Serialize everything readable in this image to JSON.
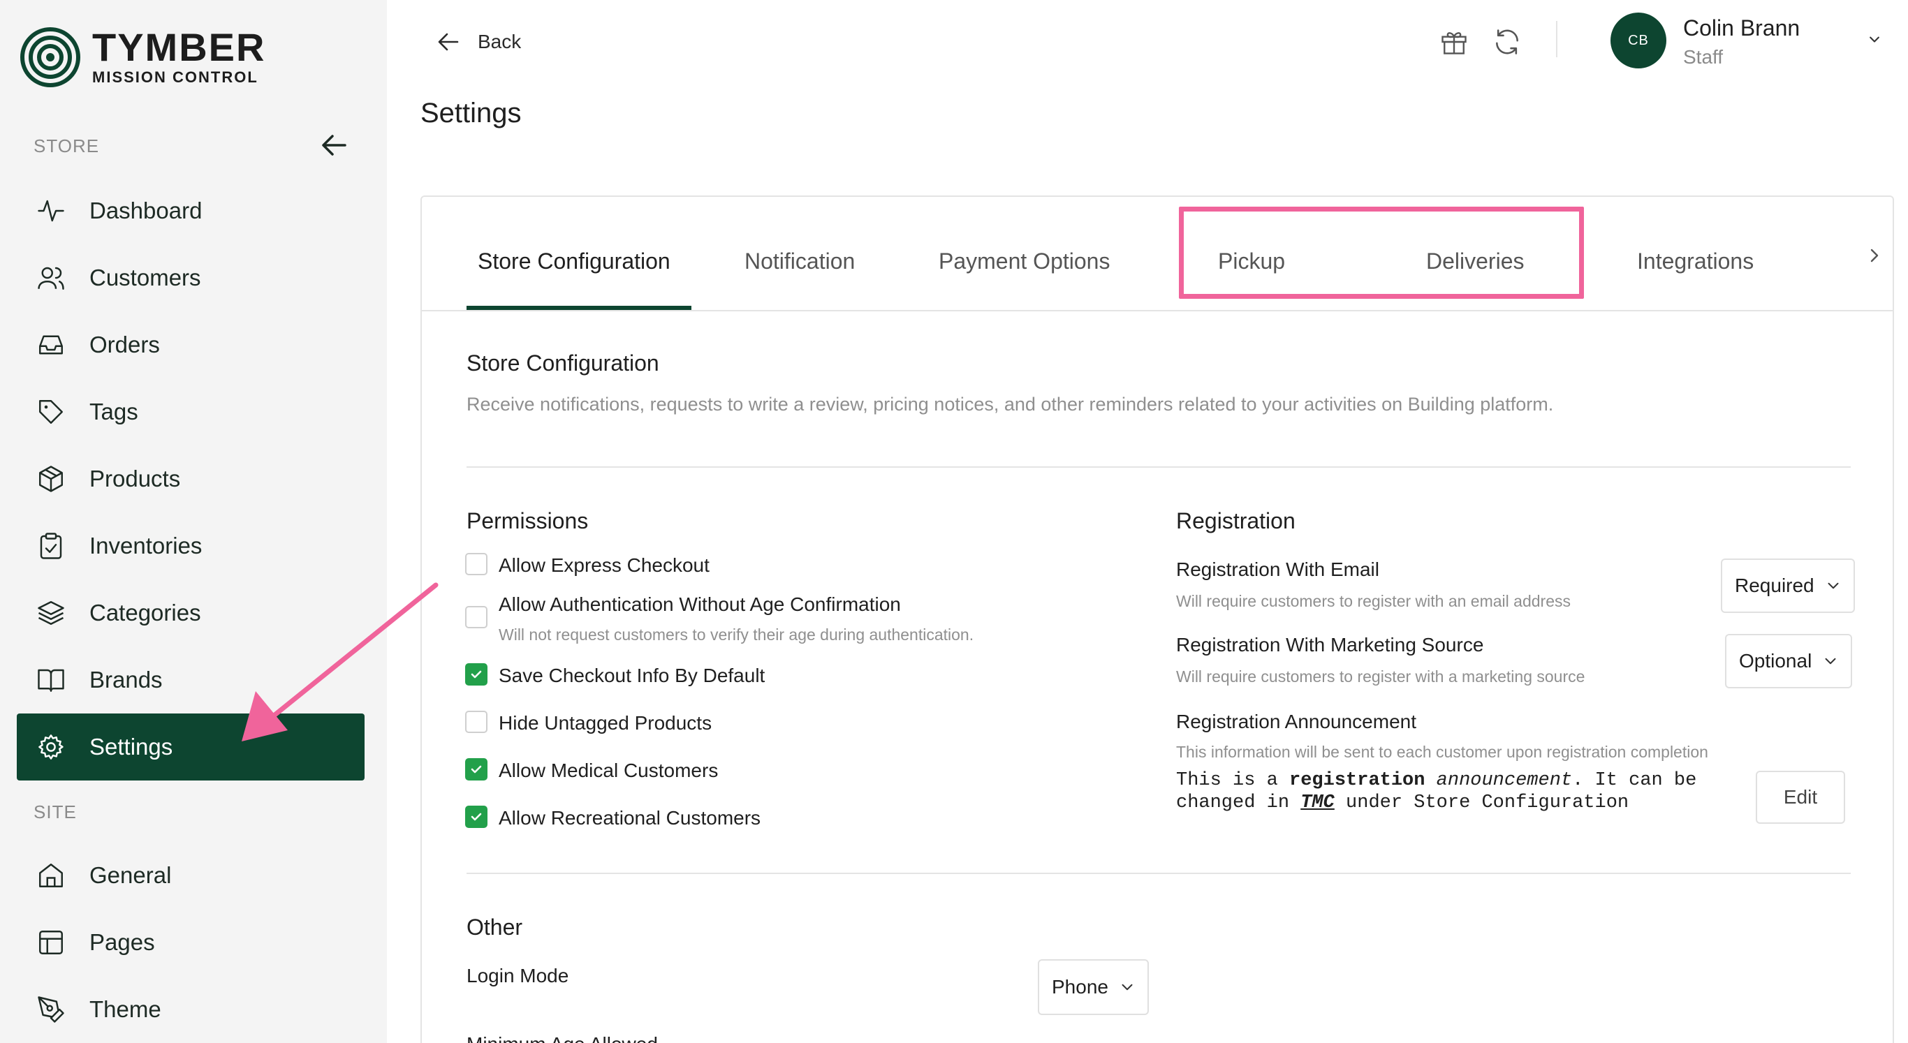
{
  "brand": {
    "title": "TYMBER",
    "subtitle": "MISSION CONTROL",
    "color": "#0d4530"
  },
  "sidebar": {
    "store_label": "STORE",
    "site_label": "SITE",
    "store_items": [
      {
        "label": "Dashboard",
        "icon": "activity-icon"
      },
      {
        "label": "Customers",
        "icon": "users-icon"
      },
      {
        "label": "Orders",
        "icon": "inbox-icon"
      },
      {
        "label": "Tags",
        "icon": "tag-icon"
      },
      {
        "label": "Products",
        "icon": "box-icon"
      },
      {
        "label": "Inventories",
        "icon": "clipboard-check-icon"
      },
      {
        "label": "Categories",
        "icon": "layers-icon"
      },
      {
        "label": "Brands",
        "icon": "book-open-icon"
      },
      {
        "label": "Settings",
        "icon": "gear-icon",
        "active": true
      }
    ],
    "site_items": [
      {
        "label": "General",
        "icon": "home-icon"
      },
      {
        "label": "Pages",
        "icon": "layout-icon"
      },
      {
        "label": "Theme",
        "icon": "pen-tool-icon"
      }
    ]
  },
  "header": {
    "back_label": "Back",
    "page_title": "Settings",
    "icons": [
      "gift-icon",
      "refresh-icon"
    ],
    "user": {
      "initials": "CB",
      "name": "Colin Brann",
      "role": "Staff"
    }
  },
  "tabs": [
    {
      "label": "Store Configuration",
      "active": true
    },
    {
      "label": "Notification"
    },
    {
      "label": "Payment Options"
    },
    {
      "label": "Pickup"
    },
    {
      "label": "Deliveries"
    },
    {
      "label": "Integrations"
    }
  ],
  "store_config": {
    "title": "Store Configuration",
    "description": "Receive notifications, requests to write a review, pricing notices, and other reminders related to your activities on Building platform."
  },
  "permissions": {
    "title": "Permissions",
    "items": [
      {
        "label": "Allow Express Checkout",
        "checked": false
      },
      {
        "label": "Allow Authentication Without Age Confirmation",
        "help": "Will not request customers to verify their age during authentication.",
        "checked": false
      },
      {
        "label": "Save Checkout Info By Default",
        "checked": true
      },
      {
        "label": "Hide Untagged Products",
        "checked": false
      },
      {
        "label": "Allow Medical Customers",
        "checked": true
      },
      {
        "label": "Allow Recreational Customers",
        "checked": true
      }
    ]
  },
  "registration": {
    "title": "Registration",
    "email": {
      "label": "Registration With Email",
      "help": "Will require customers to register with an email address",
      "value": "Required"
    },
    "marketing": {
      "label": "Registration With Marketing Source",
      "help": "Will require customers to register with a marketing source",
      "value": "Optional"
    },
    "announcement": {
      "label": "Registration Announcement",
      "help": "This information will be sent to each customer upon registration completion",
      "text_parts": [
        "This is a ",
        "registration",
        " ",
        "announcement",
        ". It can be changed in ",
        "TMC",
        " under Store Configuration"
      ],
      "edit_label": "Edit"
    }
  },
  "other": {
    "title": "Other",
    "login_mode_label": "Login Mode",
    "login_mode_value": "Phone",
    "min_age_label": "Minimum Age Allowed"
  },
  "colors": {
    "accent": "#0d4530",
    "checkbox_checked": "#22a04a",
    "annotation": "#f0649b"
  }
}
